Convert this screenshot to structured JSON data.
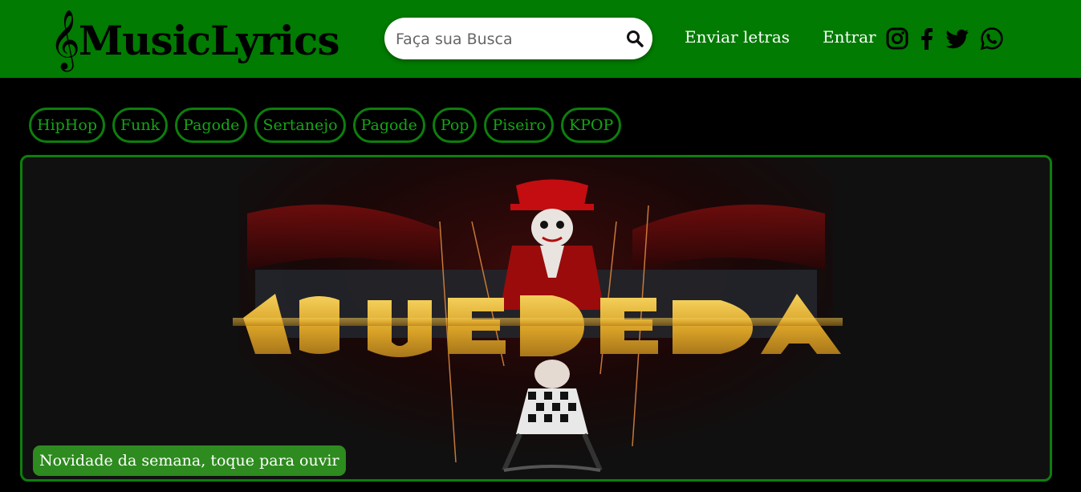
{
  "header": {
    "logo_icon": "𝄞",
    "logo_text": "MusicLyrics",
    "search": {
      "placeholder": "Faça sua Busca",
      "value": "",
      "icon": "search-icon"
    },
    "nav": {
      "send_lyrics": "Enviar letras",
      "login": "Entrar"
    },
    "social": [
      "instagram-icon",
      "facebook-icon",
      "twitter-icon",
      "whatsapp-icon"
    ]
  },
  "genres": [
    "HipHop",
    "Funk",
    "Pagode",
    "Sertanejo",
    "Pagode",
    "Pop",
    "Piseiro",
    "KPOP"
  ],
  "banner": {
    "title": "A QUEDA",
    "caption": "Novidade da semana, toque para ouvir"
  },
  "colors": {
    "header_bg": "#017b01",
    "accent_green": "#0d7e0d",
    "genre_text": "#15a515",
    "caption_bg": "#2e8b1f",
    "title_gold": "#e1ad2f"
  }
}
